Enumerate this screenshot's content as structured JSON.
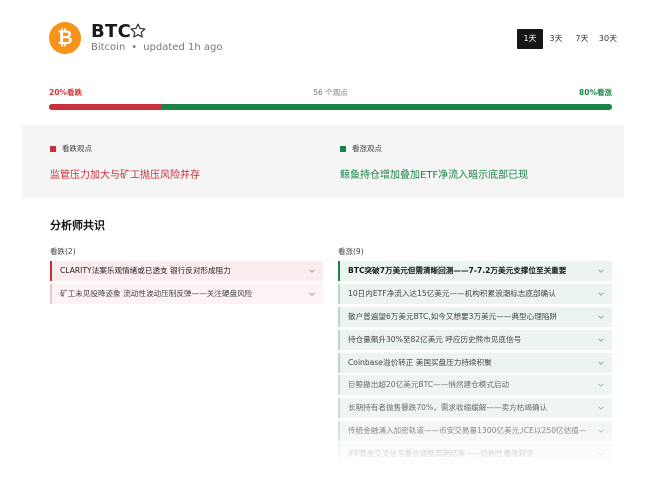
{
  "coin": {
    "ticker": "BTC",
    "name": "Bitcoin",
    "updated": "updated 1h ago",
    "logo_glyph": "₿",
    "logo_color": "#f7931a",
    "favorite_icon": "star-outline-icon"
  },
  "ranges": {
    "selected": "1天",
    "options": [
      "1天",
      "3天",
      "7天",
      "30天"
    ]
  },
  "sentiment": {
    "bear_label": "20%看跌",
    "bull_label": "80%看涨",
    "count_label": "56 个观点",
    "bear_pct": 20,
    "bull_pct": 80,
    "bear_color": "#c9303a",
    "bull_color": "#1a8348"
  },
  "views": {
    "bear": {
      "tag": "看跌观点",
      "title": "监管压力加大与矿工抛压风险并存"
    },
    "bull": {
      "tag": "看涨观点",
      "title": "鲸鱼持仓增加叠加ETF净流入暗示底部已现"
    }
  },
  "consensus": {
    "title": "分析师共识",
    "bear_header": "看跌(2)",
    "bull_header": "看涨(9)",
    "bear_items": [
      "CLARITY法案乐观情绪或已透支 银行反对形成阻力",
      "矿工未见投降迹象 流动性波动压制反弹——关注硬盘风险"
    ],
    "bull_items": [
      "BTC突破7万美元但需清晰回测——7-7.2万美元支撑位至关重要",
      "10日内ETF净流入达15亿美元——机构积累浪潮标志底部确认",
      "散户普遍望6万美元BTC,如今又想要3万美元——典型心理陷阱",
      "持仓量飙升30%至82亿美元 呼应历史熊市见底信号",
      "Coinbase溢价转正 美国买盘压力持续积聚",
      "巨鲸撤出超20亿美元BTC——悄然建仓模式启动",
      "长期持有者抛售暴跌70%，需求收缩缓解——卖方枯竭确认",
      "传统金融涌入加密轨道——币安交易量1300亿美元,ICE以250亿估值—",
      "IFP黄金交叉信号最长调整周期结束——结构性看涨转变"
    ]
  }
}
